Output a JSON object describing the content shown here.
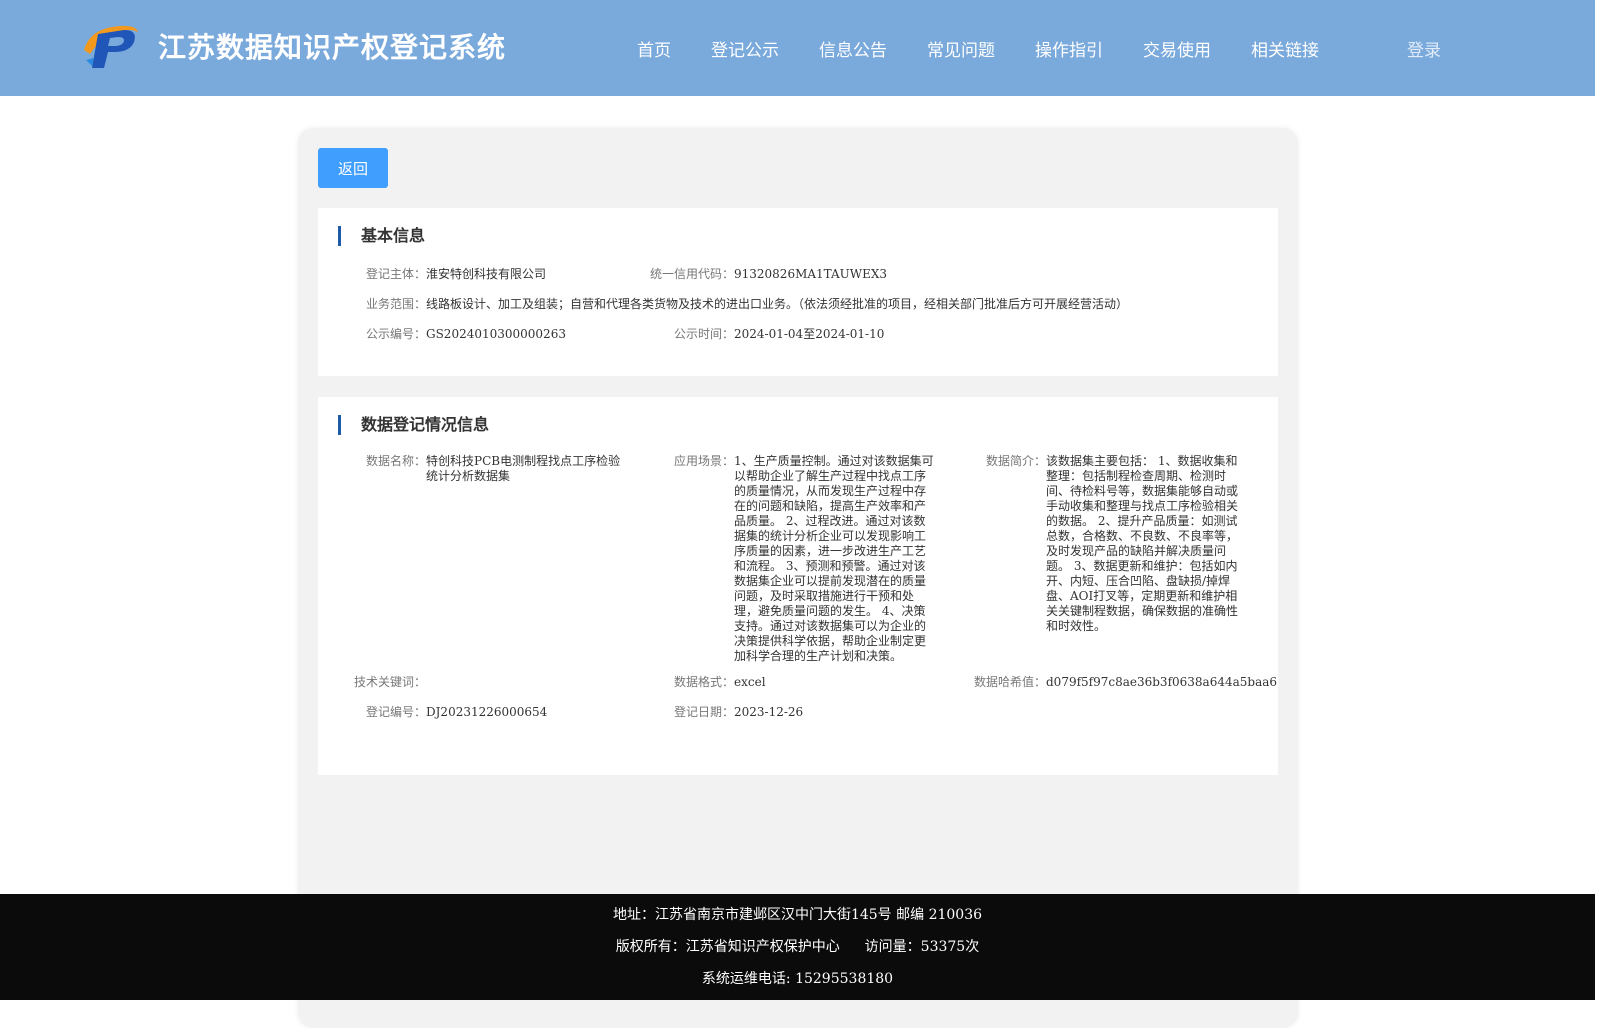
{
  "header": {
    "site_title": "江苏数据知识产权登记系统",
    "logo_icon": "p-logo-icon",
    "nav": [
      "首页",
      "登记公示",
      "信息公告",
      "常见问题",
      "操作指引",
      "交易使用",
      "相关链接"
    ],
    "login_label": "登录"
  },
  "actions": {
    "back_label": "返回"
  },
  "basic_info": {
    "title": "基本信息",
    "subject_label": "登记主体：",
    "subject_value": "淮安特创科技有限公司",
    "credit_code_label": "统一信用代码：",
    "credit_code_value": "91320826MA1TAUWEX3",
    "scope_label": "业务范围：",
    "scope_value": "线路板设计、加工及组装；自营和代理各类货物及技术的进出口业务。（依法须经批准的项目，经相关部门批准后方可开展经营活动）",
    "notice_no_label": "公示编号：",
    "notice_no_value": "GS2024010300000263",
    "notice_time_label": "公示时间：",
    "notice_time_value": "2024-01-04至2024-01-10"
  },
  "data_info": {
    "title": "数据登记情况信息",
    "name_label": "数据名称：",
    "name_value": "特创科技PCB电测制程找点工序检验统计分析数据集",
    "scenario_label": "应用场景：",
    "scenario_value": "1、生产质量控制。通过对该数据集可以帮助企业了解生产过程中找点工序的质量情况，从而发现生产过程中存在的问题和缺陷，提高生产效率和产品质量。 2、过程改进。通过对该数据集的统计分析企业可以发现影响工序质量的因素，进一步改进生产工艺和流程。 3、预测和预警。通过对该数据集企业可以提前发现潜在的质量问题，及时采取措施进行干预和处理，避免质量问题的发生。 4、决策支持。通过对该数据集可以为企业的决策提供科学依据，帮助企业制定更加科学合理的生产计划和决策。",
    "intro_label": "数据简介：",
    "intro_value": "该数据集主要包括： 1、数据收集和整理：包括制程检查周期、检测时间、待检料号等，数据集能够自动或手动收集和整理与找点工序检验相关的数据。 2、提升产品质量：如测试总数，合格数、不良数、不良率等，及时发现产品的缺陷并解决质量问题。 3、数据更新和维护：包括如内开、内短、压合凹陷、盘缺损/掉焊盘、AOI打叉等，定期更新和维护相关关键制程数据，确保数据的准确性和时效性。",
    "keywords_label": "技术关键词：",
    "keywords_value": "",
    "format_label": "数据格式：",
    "format_value": "excel",
    "hash_label": "数据哈希值：",
    "hash_value": "d079f5f97c8ae36b3f0638a644a5baa6",
    "reg_no_label": "登记编号：",
    "reg_no_value": "DJ20231226000654",
    "reg_date_label": "登记日期：",
    "reg_date_value": "2023-12-26"
  },
  "footer": {
    "address": "地址：江苏省南京市建邺区汉中门大街145号 邮编 210036",
    "copyright": "版权所有：江苏省知识产权保护中心",
    "visits": "访问量：53375次",
    "phone": "系统运维电话: 15295538180"
  }
}
